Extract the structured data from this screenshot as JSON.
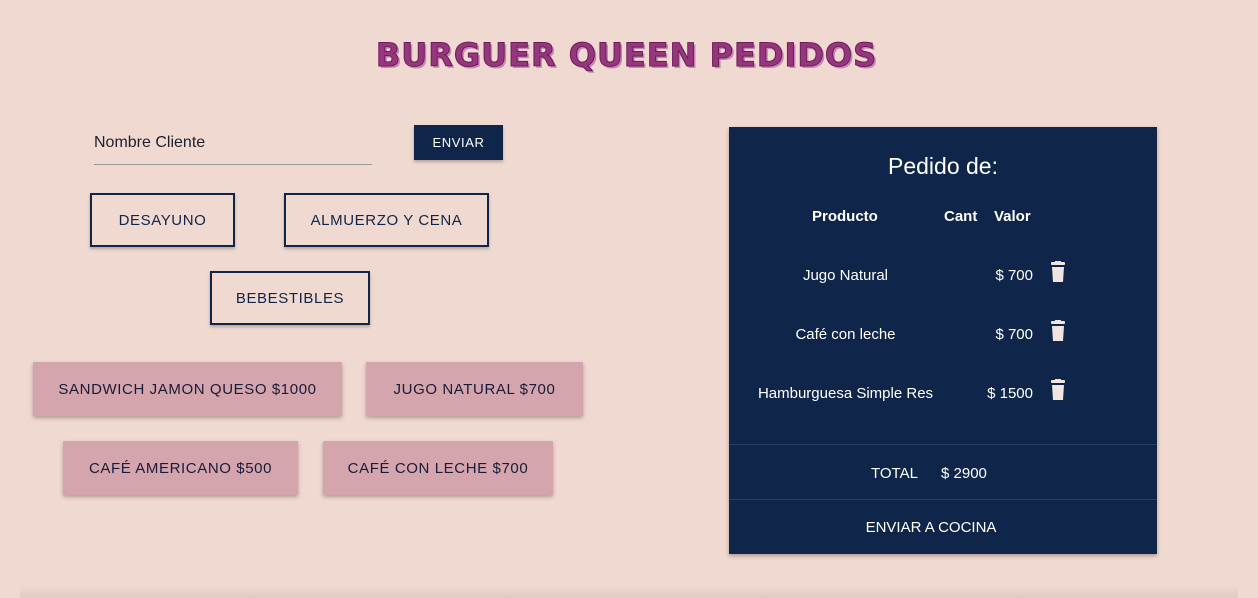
{
  "header": {
    "title": "BURGUER QUEEN PEDIDOS"
  },
  "client": {
    "placeholder": "Nombre Cliente",
    "value": "",
    "send_label": "ENVIAR"
  },
  "categories": [
    {
      "label": "DESAYUNO"
    },
    {
      "label": "ALMUERZO Y CENA"
    },
    {
      "label": "BEBESTIBLES"
    }
  ],
  "products": [
    {
      "label": "SANDWICH JAMON QUESO $1000"
    },
    {
      "label": "JUGO NATURAL $700"
    },
    {
      "label": "CAFÉ AMERICANO $500"
    },
    {
      "label": "CAFÉ CON LECHE $700"
    }
  ],
  "order": {
    "title": "Pedido de:",
    "headers": {
      "product": "Producto",
      "qty": "Cant",
      "value": "Valor"
    },
    "items": [
      {
        "product": "Jugo Natural",
        "value": "$ 700",
        "icon": "trash-icon"
      },
      {
        "product": "Café con leche",
        "value": "$ 700",
        "icon": "trash-icon"
      },
      {
        "product": "Hamburguesa Simple Res",
        "value": "$ 1500",
        "icon": "trash-icon"
      }
    ],
    "total_label": "TOTAL",
    "total_value": "$ 2900",
    "send_kitchen_label": "ENVIAR A COCINA"
  },
  "colors": {
    "background": "#f0d9d0",
    "accent": "#96367d",
    "primary": "#0f254a",
    "product_button": "#d4a5ad"
  }
}
